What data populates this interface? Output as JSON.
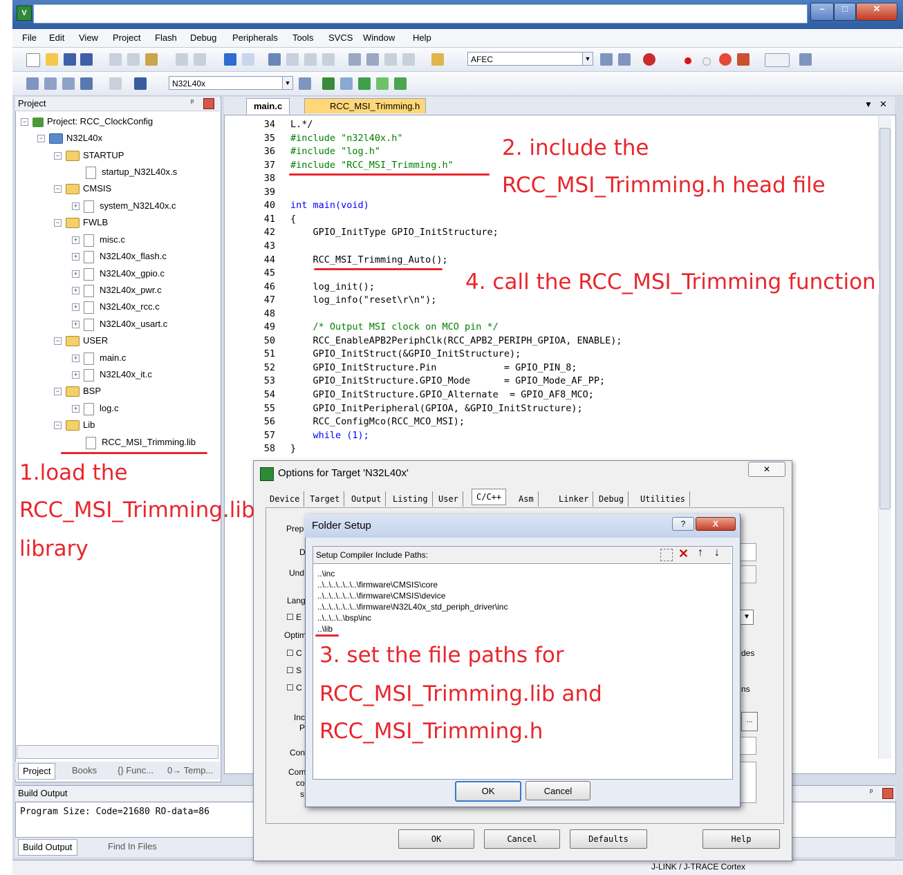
{
  "window": {
    "app_icon": "V",
    "title": ""
  },
  "menu": [
    "File",
    "Edit",
    "View",
    "Project",
    "Flash",
    "Debug",
    "Peripherals",
    "Tools",
    "SVCS",
    "Window",
    "Help"
  ],
  "toolbar": {
    "target_combo": "AFEC",
    "device_combo": "N32L40x"
  },
  "project_pane": {
    "header": "Project",
    "tree": [
      {
        "label": "Project: RCC_ClockConfig",
        "level": 0
      },
      {
        "label": "N32L40x",
        "level": 1
      },
      {
        "label": "STARTUP",
        "level": 2
      },
      {
        "label": "startup_N32L40x.s",
        "level": 3
      },
      {
        "label": "CMSIS",
        "level": 2
      },
      {
        "label": "system_N32L40x.c",
        "level": 3
      },
      {
        "label": "FWLB",
        "level": 2
      },
      {
        "label": "misc.c",
        "level": 3
      },
      {
        "label": "N32L40x_flash.c",
        "level": 3
      },
      {
        "label": "N32L40x_gpio.c",
        "level": 3
      },
      {
        "label": "N32L40x_pwr.c",
        "level": 3
      },
      {
        "label": "N32L40x_rcc.c",
        "level": 3
      },
      {
        "label": "N32L40x_usart.c",
        "level": 3
      },
      {
        "label": "USER",
        "level": 2
      },
      {
        "label": "main.c",
        "level": 3
      },
      {
        "label": "N32L40x_it.c",
        "level": 3
      },
      {
        "label": "BSP",
        "level": 2
      },
      {
        "label": "log.c",
        "level": 3
      },
      {
        "label": "Lib",
        "level": 2
      },
      {
        "label": "RCC_MSI_Trimming.lib",
        "level": 3
      }
    ],
    "tabs": [
      "Project",
      "Books",
      "{} Func...",
      "0→ Temp..."
    ]
  },
  "editor": {
    "tabs": [
      "main.c",
      "RCC_MSI_Trimming.h"
    ],
    "lines": [
      {
        "n": "34",
        "t": "L.*/"
      },
      {
        "n": "35",
        "t": "#include \"n32l40x.h\""
      },
      {
        "n": "36",
        "t": "#include \"log.h\""
      },
      {
        "n": "37",
        "t": "#include \"RCC_MSI_Trimming.h\""
      },
      {
        "n": "38",
        "t": ""
      },
      {
        "n": "39",
        "t": ""
      },
      {
        "n": "40",
        "t": "int main(void)"
      },
      {
        "n": "41",
        "t": "{"
      },
      {
        "n": "42",
        "t": "    GPIO_InitType GPIO_InitStructure;"
      },
      {
        "n": "43",
        "t": "    "
      },
      {
        "n": "44",
        "t": "    RCC_MSI_Trimming_Auto();"
      },
      {
        "n": "45",
        "t": "    "
      },
      {
        "n": "46",
        "t": "    log_init();"
      },
      {
        "n": "47",
        "t": "    log_info(\"reset\\r\\n\");"
      },
      {
        "n": "48",
        "t": "    "
      },
      {
        "n": "49",
        "t": "    /* Output MSI clock on MCO pin */"
      },
      {
        "n": "50",
        "t": "    RCC_EnableAPB2PeriphClk(RCC_APB2_PERIPH_GPIOA, ENABLE);"
      },
      {
        "n": "51",
        "t": "    GPIO_InitStruct(&GPIO_InitStructure);"
      },
      {
        "n": "52",
        "t": "    GPIO_InitStructure.Pin            = GPIO_PIN_8;"
      },
      {
        "n": "53",
        "t": "    GPIO_InitStructure.GPIO_Mode      = GPIO_Mode_AF_PP;"
      },
      {
        "n": "54",
        "t": "    GPIO_InitStructure.GPIO_Alternate  = GPIO_AF8_MCO;"
      },
      {
        "n": "55",
        "t": "    GPIO_InitPeripheral(GPIOA, &GPIO_InitStructure);"
      },
      {
        "n": "56",
        "t": "    RCC_ConfigMco(RCC_MCO_MSI);"
      },
      {
        "n": "57",
        "t": "    while (1);"
      },
      {
        "n": "58",
        "t": "}"
      }
    ]
  },
  "build_output": {
    "header": "Build Output",
    "text": "Program Size: Code=21680 RO-data=86",
    "tabs": [
      "Build Output",
      "Find In Files"
    ]
  },
  "status": "J-LINK / J-TRACE Cortex",
  "options_dialog": {
    "title": "Options for Target 'N32L40x'",
    "tabs": [
      "Device",
      "Target",
      "Output",
      "Listing",
      "User",
      "C/C++",
      "Asm",
      "Linker",
      "Debug",
      "Utilities"
    ],
    "buttons": {
      "ok": "OK",
      "cancel": "Cancel",
      "defaults": "Defaults",
      "help": "Help"
    },
    "partial_labels": [
      "Prep",
      "D",
      "Und",
      "Lang",
      "E",
      "Optim",
      "C",
      "S",
      "C",
      "Inc",
      "P",
      "Con",
      "Com",
      "co",
      "s",
      "des",
      "ns",
      "..."
    ]
  },
  "folder_dialog": {
    "title": "Folder Setup",
    "help_btn": "?",
    "close_btn": "X",
    "list_header": "Setup Compiler Include Paths:",
    "paths": [
      "..\\inc",
      "..\\..\\..\\..\\..\\..\\firmware\\CMSIS\\core",
      "..\\..\\..\\..\\..\\..\\firmware\\CMSIS\\device",
      "..\\..\\..\\..\\..\\..\\firmware\\N32L40x_std_periph_driver\\inc",
      "..\\..\\..\\..\\bsp\\inc",
      "..\\lib"
    ],
    "ok": "OK",
    "cancel": "Cancel"
  },
  "annotations": {
    "a1_l1": "1.load the",
    "a1_l2": "RCC_MSI_Trimming.lib",
    "a1_l3": "library",
    "a2_l1": "2. include the",
    "a2_l2": "RCC_MSI_Trimming.h head file",
    "a3_l1": "3. set the file paths for",
    "a3_l2": "RCC_MSI_Trimming.lib and",
    "a3_l3": "RCC_MSI_Trimming.h",
    "a4": "4. call the RCC_MSI_Trimming function"
  },
  "colors": {
    "annotation": "#e8262d",
    "title_bar": "#3b6cb0",
    "keyword": "#0000ff",
    "string": "#a31515",
    "comment": "#008000"
  }
}
